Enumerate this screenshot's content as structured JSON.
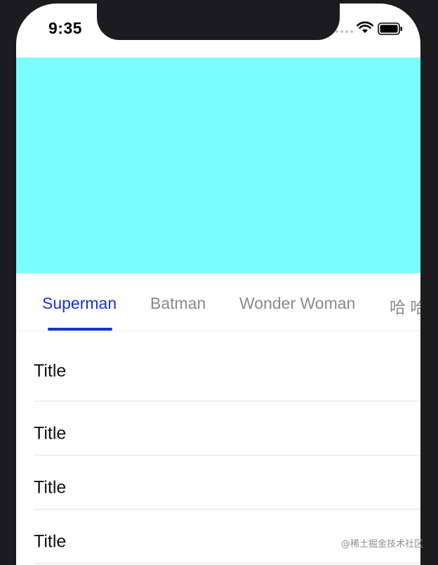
{
  "status_bar": {
    "time": "9:35"
  },
  "hero": {
    "color": "#79fdff"
  },
  "tabs": [
    {
      "label": "Superman",
      "active": true
    },
    {
      "label": "Batman",
      "active": false
    },
    {
      "label": "Wonder Woman",
      "active": false
    },
    {
      "label": "哈 哈",
      "active": false
    }
  ],
  "accent_color": "#1434d8",
  "list": {
    "items": [
      {
        "title": "Title"
      },
      {
        "title": "Title"
      },
      {
        "title": "Title"
      },
      {
        "title": "Title"
      }
    ]
  },
  "watermark": "@稀土掘金技术社区",
  "icons": {
    "signal": "signal-dots-icon",
    "wifi": "wifi-icon",
    "battery": "battery-icon"
  }
}
